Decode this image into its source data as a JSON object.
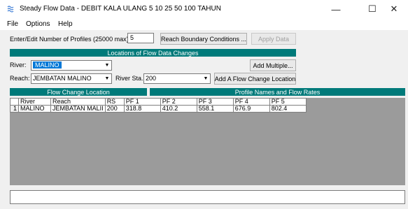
{
  "window": {
    "title": "Steady Flow Data - DEBIT KALA ULANG 5 10 25 50 100 TAHUN",
    "minimize": "—",
    "maximize": "☐",
    "close": "✕"
  },
  "menu": [
    "File",
    "Options",
    "Help"
  ],
  "profiles": {
    "label": "Enter/Edit Number of Profiles (25000 max):",
    "value": "5"
  },
  "buttons": {
    "reach_boundary": "Reach Boundary Conditions ...",
    "apply_data": "Apply Data",
    "add_multiple": "Add Multiple...",
    "add_flow_change": "Add A Flow Change Location"
  },
  "locations": {
    "header": "Locations of Flow Data Changes",
    "river_label": "River:",
    "river_value": "MALINO",
    "reach_label": "Reach:",
    "reach_value": "JEMBATAN MALINO",
    "river_sta_label": "River Sta.:",
    "river_sta_value": "200"
  },
  "table": {
    "flow_change_header": "Flow Change Location",
    "profile_header": "Profile Names and Flow Rates",
    "columns": [
      "River",
      "Reach",
      "RS",
      "PF 1",
      "PF 2",
      "PF 3",
      "PF 4",
      "PF 5"
    ],
    "rows": [
      {
        "index": "1",
        "cells": [
          "MALINO",
          "JEMBATAN MALII",
          "200",
          "318.8",
          "410.2",
          "558.1",
          "676.9",
          "802.4"
        ]
      }
    ]
  }
}
